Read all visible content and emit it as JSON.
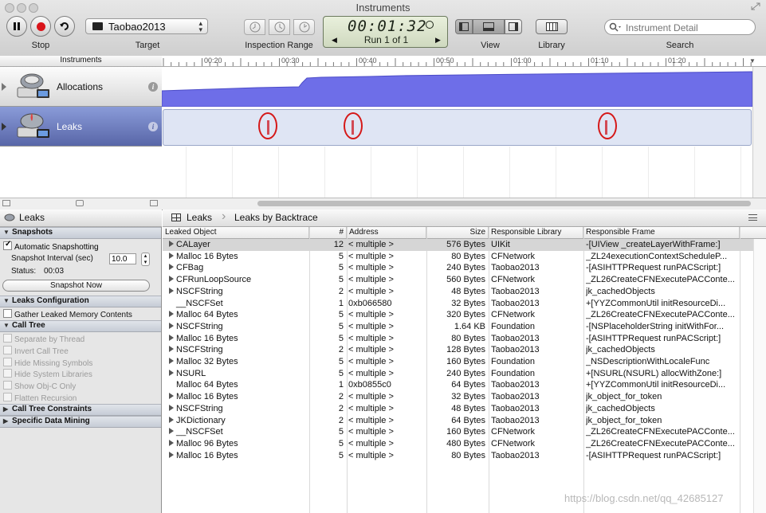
{
  "window": {
    "title": "Instruments"
  },
  "toolbar": {
    "stop_label": "Stop",
    "target_label": "Target",
    "target_value": "Taobao2013",
    "inspection_range_label": "Inspection Range",
    "time": "00:01:32",
    "run": "Run 1 of 1",
    "view_label": "View",
    "library_label": "Library",
    "search_placeholder": "Instrument Detail",
    "search_label": "Search"
  },
  "instruments_header": "Instruments",
  "timeline_ticks": [
    "00:20",
    "00:30",
    "00:40",
    "00:50",
    "01:00",
    "01:10",
    "01:20"
  ],
  "instruments": [
    {
      "name": "Allocations"
    },
    {
      "name": "Leaks"
    }
  ],
  "left_panel": {
    "title": "Leaks",
    "snapshots": {
      "title": "Snapshots",
      "auto_label": "Automatic Snapshotting",
      "interval_label": "Snapshot Interval (sec)",
      "interval_value": "10.0",
      "status_label": "Status:",
      "status_value": "00:03",
      "snapshot_now": "Snapshot Now"
    },
    "leaks_config": {
      "title": "Leaks Configuration",
      "gather_label": "Gather Leaked Memory Contents"
    },
    "call_tree": {
      "title": "Call Tree",
      "options": [
        "Separate by Thread",
        "Invert Call Tree",
        "Hide Missing Symbols",
        "Hide System Libraries",
        "Show Obj-C Only",
        "Flatten Recursion"
      ]
    },
    "call_tree_constraints": "Call Tree Constraints",
    "specific_data_mining": "Specific Data Mining"
  },
  "breadcrumb": {
    "root": "Leaks",
    "current": "Leaks by Backtrace"
  },
  "table": {
    "headers": {
      "object": "Leaked Object",
      "count": "#",
      "address": "Address",
      "size": "Size",
      "library": "Responsible Library",
      "frame": "Responsible Frame"
    },
    "rows": [
      {
        "object": "CALayer",
        "count": "12",
        "address": "< multiple >",
        "size": "576 Bytes",
        "library": "UIKit",
        "frame": "-[UIView _createLayerWithFrame:]"
      },
      {
        "object": "Malloc 16 Bytes",
        "count": "5",
        "address": "< multiple >",
        "size": "80 Bytes",
        "library": "CFNetwork",
        "frame": "_ZL24executionContextScheduleP..."
      },
      {
        "object": "CFBag",
        "count": "5",
        "address": "< multiple >",
        "size": "240 Bytes",
        "library": "Taobao2013",
        "frame": "-[ASIHTTPRequest runPACScript:]"
      },
      {
        "object": "CFRunLoopSource",
        "count": "5",
        "address": "< multiple >",
        "size": "560 Bytes",
        "library": "CFNetwork",
        "frame": "_ZL26CreateCFNExecutePACConte..."
      },
      {
        "object": "NSCFString",
        "count": "2",
        "address": "< multiple >",
        "size": "48 Bytes",
        "library": "Taobao2013",
        "frame": "jk_cachedObjects"
      },
      {
        "object": "__NSCFSet",
        "count": "1",
        "address": "0xb066580",
        "size": "32 Bytes",
        "library": "Taobao2013",
        "frame": "+[YYZCommonUtil initResourceDi..."
      },
      {
        "object": "Malloc 64 Bytes",
        "count": "5",
        "address": "< multiple >",
        "size": "320 Bytes",
        "library": "CFNetwork",
        "frame": "_ZL26CreateCFNExecutePACConte..."
      },
      {
        "object": "NSCFString",
        "count": "5",
        "address": "< multiple >",
        "size": "1.64 KB",
        "library": "Foundation",
        "frame": "-[NSPlaceholderString initWithFor..."
      },
      {
        "object": "Malloc 16 Bytes",
        "count": "5",
        "address": "< multiple >",
        "size": "80 Bytes",
        "library": "Taobao2013",
        "frame": "-[ASIHTTPRequest runPACScript:]"
      },
      {
        "object": "NSCFString",
        "count": "2",
        "address": "< multiple >",
        "size": "128 Bytes",
        "library": "Taobao2013",
        "frame": "jk_cachedObjects"
      },
      {
        "object": "Malloc 32 Bytes",
        "count": "5",
        "address": "< multiple >",
        "size": "160 Bytes",
        "library": "Foundation",
        "frame": "_NSDescriptionWithLocaleFunc"
      },
      {
        "object": "NSURL",
        "count": "5",
        "address": "< multiple >",
        "size": "240 Bytes",
        "library": "Foundation",
        "frame": "+[NSURL(NSURL) allocWithZone:]"
      },
      {
        "object": "Malloc 64 Bytes",
        "count": "1",
        "address": "0xb0855c0",
        "size": "64 Bytes",
        "library": "Taobao2013",
        "frame": "+[YYZCommonUtil initResourceDi..."
      },
      {
        "object": "Malloc 16 Bytes",
        "count": "2",
        "address": "< multiple >",
        "size": "32 Bytes",
        "library": "Taobao2013",
        "frame": "jk_object_for_token"
      },
      {
        "object": "NSCFString",
        "count": "2",
        "address": "< multiple >",
        "size": "48 Bytes",
        "library": "Taobao2013",
        "frame": "jk_cachedObjects"
      },
      {
        "object": "JKDictionary",
        "count": "2",
        "address": "< multiple >",
        "size": "64 Bytes",
        "library": "Taobao2013",
        "frame": "jk_object_for_token"
      },
      {
        "object": "__NSCFSet",
        "count": "5",
        "address": "< multiple >",
        "size": "160 Bytes",
        "library": "CFNetwork",
        "frame": "_ZL26CreateCFNExecutePACConte..."
      },
      {
        "object": "Malloc 96 Bytes",
        "count": "5",
        "address": "< multiple >",
        "size": "480 Bytes",
        "library": "CFNetwork",
        "frame": "_ZL26CreateCFNExecutePACConte..."
      },
      {
        "object": "Malloc 16 Bytes",
        "count": "5",
        "address": "< multiple >",
        "size": "80 Bytes",
        "library": "Taobao2013",
        "frame": "-[ASIHTTPRequest runPACScript:]"
      }
    ]
  },
  "watermark": "https://blog.csdn.net/qq_42685127",
  "colors": {
    "allocations_fill": "#6e6ee8",
    "leak_marker": "#d24a55",
    "annotation_circle": "#d51818",
    "selected_instrument": "#6271b7"
  }
}
